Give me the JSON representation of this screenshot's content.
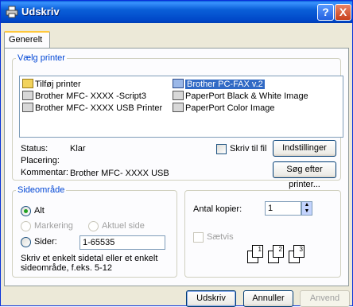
{
  "window": {
    "title": "Udskriv",
    "help_button": "?",
    "close_button": "X"
  },
  "tabs": [
    {
      "label": "Generelt",
      "selected": true
    }
  ],
  "select_printer": {
    "legend": "Vælg printer",
    "printers": [
      {
        "name": "Tilføj printer",
        "icon": "add-printer-icon",
        "selected": false
      },
      {
        "name": "Brother MFC-  XXXX        -Script3",
        "icon": "printer-icon",
        "selected": false
      },
      {
        "name": "Brother MFC- XXXX   USB Printer",
        "icon": "printer-icon",
        "selected": false
      },
      {
        "name": "Brother PC-FAX v.2",
        "icon": "fax-printer-icon",
        "selected": true
      },
      {
        "name": "PaperPort Black & White Image",
        "icon": "printer-icon",
        "selected": false
      },
      {
        "name": "PaperPort Color Image",
        "icon": "printer-icon",
        "selected": false
      }
    ],
    "status_label": "Status:",
    "status_value": "Klar",
    "location_label": "Placering:",
    "location_value": "",
    "comment_label": "Kommentar:",
    "comment_value": "Brother MFC- XXXX   USB",
    "print_to_file_label": "Skriv til fil",
    "print_to_file_checked": false,
    "preferences_button": "Indstillinger",
    "find_printer_button": "Søg efter printer..."
  },
  "page_range": {
    "legend": "Sideområde",
    "all_label": "Alt",
    "selection_label": "Markering",
    "current_page_label": "Aktuel side",
    "pages_label": "Sider:",
    "pages_value": "1-65535",
    "selected_option": "all",
    "help_text_line1": "Skriv et enkelt sidetal eller et enkelt",
    "help_text_line2": "sideområde, f.eks. 5-12"
  },
  "copies": {
    "count_label": "Antal kopier:",
    "count_value": "1",
    "collate_label": "Sætvis",
    "collate_checked": false,
    "collate_pages": [
      "1",
      "1",
      "2",
      "2",
      "3",
      "3"
    ]
  },
  "footer": {
    "print_button": "Udskriv",
    "cancel_button": "Annuller",
    "apply_button": "Anvend"
  },
  "colors": {
    "titlebar": "#0a5fd8",
    "group_legend": "#0046d5",
    "selection": "#316ac5",
    "dialog_bg": "#ece9d8"
  }
}
